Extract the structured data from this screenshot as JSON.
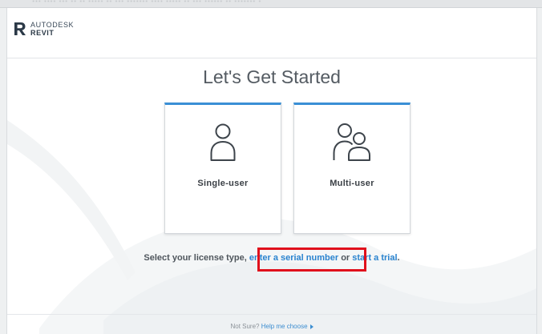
{
  "top_strip": {
    "text": "··· ···· ··· ·· ·· ····· ·· ··· ······· ···· ····· ·· ··· ······ ·· ······· ·"
  },
  "brand": {
    "company": "AUTODESK",
    "product": "REVIT",
    "logo_icon": "revit-r-logo",
    "color": "#2b3947"
  },
  "main": {
    "title": "Let's Get Started",
    "cards": [
      {
        "label": "Single-user",
        "icon": "single-person-icon"
      },
      {
        "label": "Multi-user",
        "icon": "multi-person-icon"
      }
    ],
    "prompt": {
      "prefix": "Select your license type, ",
      "serial_link": "enter a serial number",
      "middle": " or ",
      "trial_link": "start a trial",
      "suffix": "."
    },
    "accent_color": "#3a8fd6",
    "highlight_color": "#e0101c"
  },
  "footer": {
    "prefix": "Not Sure? ",
    "link": "Help me choose",
    "arrow_icon": "play-arrow-icon"
  }
}
